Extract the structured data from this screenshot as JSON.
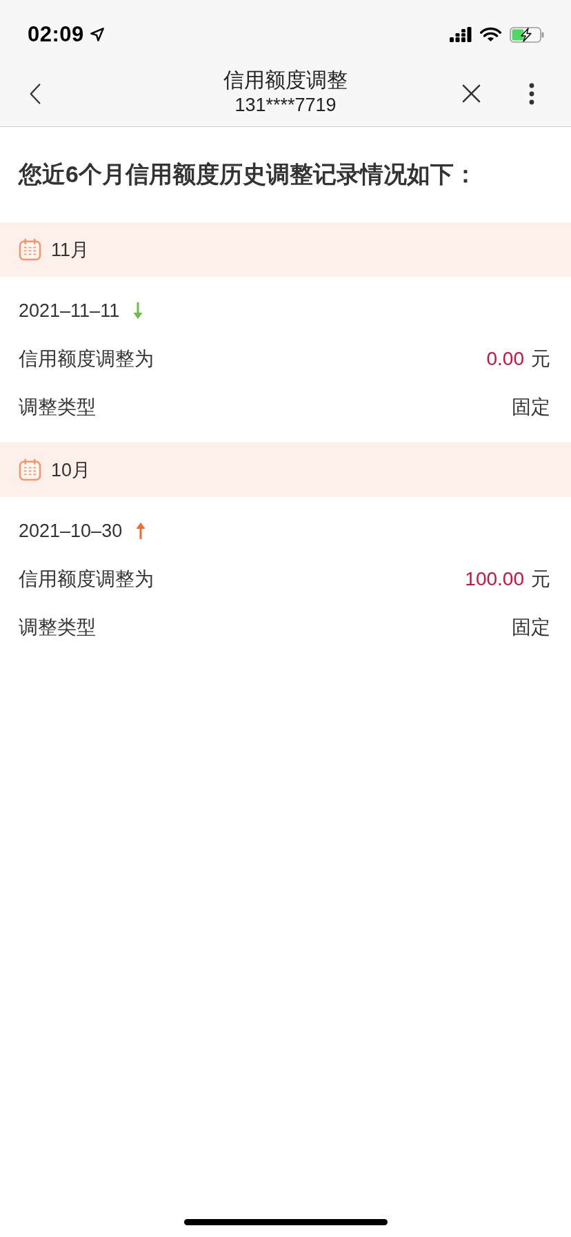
{
  "status_bar": {
    "time": "02:09"
  },
  "nav": {
    "title": "信用额度调整",
    "subtitle": "131****7719"
  },
  "heading": "您近6个月信用额度历史调整记录情况如下：",
  "months": [
    {
      "month": "11月",
      "records": [
        {
          "date": "2021–11–11",
          "kind": "down",
          "fields": [
            {
              "kind": "amount",
              "label": "信用额度调整为",
              "value": "0.00",
              "unit": "元"
            },
            {
              "kind": "text",
              "label": "调整类型",
              "value": "固定"
            }
          ]
        }
      ]
    },
    {
      "month": "10月",
      "records": [
        {
          "date": "2021–10–30",
          "kind": "up",
          "fields": [
            {
              "kind": "amount",
              "label": "信用额度调整为",
              "value": "100.00",
              "unit": "元"
            },
            {
              "kind": "text",
              "label": "调整类型",
              "value": "固定"
            }
          ]
        }
      ]
    }
  ]
}
